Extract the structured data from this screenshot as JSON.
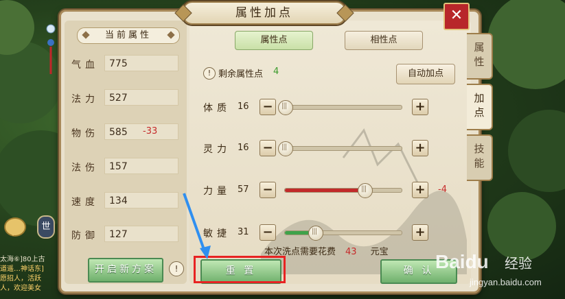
{
  "window": {
    "title": "属性加点",
    "close_label": "✕"
  },
  "side_tabs": [
    {
      "label": "属性",
      "active": false
    },
    {
      "label": "加点",
      "active": true
    },
    {
      "label": "技能",
      "active": false
    }
  ],
  "current_attributes": {
    "header": "当前属性",
    "stats": [
      {
        "label": "气血",
        "value": "775",
        "delta": ""
      },
      {
        "label": "法力",
        "value": "527",
        "delta": ""
      },
      {
        "label": "物伤",
        "value": "585",
        "delta": "-33"
      },
      {
        "label": "法伤",
        "value": "157",
        "delta": ""
      },
      {
        "label": "速度",
        "value": "134",
        "delta": ""
      },
      {
        "label": "防御",
        "value": "127",
        "delta": ""
      }
    ],
    "new_plan_button": "开启新方案",
    "hint_icon": "!"
  },
  "point_tabs": {
    "attribute_points": "属性点",
    "affinity_points": "相性点"
  },
  "remaining": {
    "icon": "!",
    "label": "剩余属性点",
    "value": "4"
  },
  "auto_button": "自动加点",
  "attributes": [
    {
      "label": "体质",
      "value": "16",
      "level": 0.0,
      "fill_color": "",
      "delta": ""
    },
    {
      "label": "灵力",
      "value": "16",
      "level": 0.0,
      "fill_color": "",
      "delta": ""
    },
    {
      "label": "力量",
      "value": "57",
      "level": 0.68,
      "fill_color": "#c22a2a",
      "delta": "-4"
    },
    {
      "label": "敏捷",
      "value": "31",
      "level": 0.26,
      "fill_color": "#3fa24a",
      "delta": ""
    }
  ],
  "button_glyphs": {
    "minus": "−",
    "plus": "+"
  },
  "cost": {
    "prefix": "本次洗点需要花费",
    "amount": "43",
    "unit": "元宝"
  },
  "reset_button": "重 置",
  "confirm_button": "确 认",
  "chat": {
    "lines": [
      "太海⑥]80上古",
      "道遥…神话东]",
      "愿招人，活跃",
      "人，欢迎美女"
    ],
    "mic_label": "世"
  },
  "watermark": {
    "brand": "Baidu",
    "cn": "经验",
    "url": "jingyan.baidu.com"
  },
  "colors": {
    "accent_green": "#3a9a2b",
    "negative_red": "#c62a2a",
    "highlight_red": "#e82222"
  }
}
